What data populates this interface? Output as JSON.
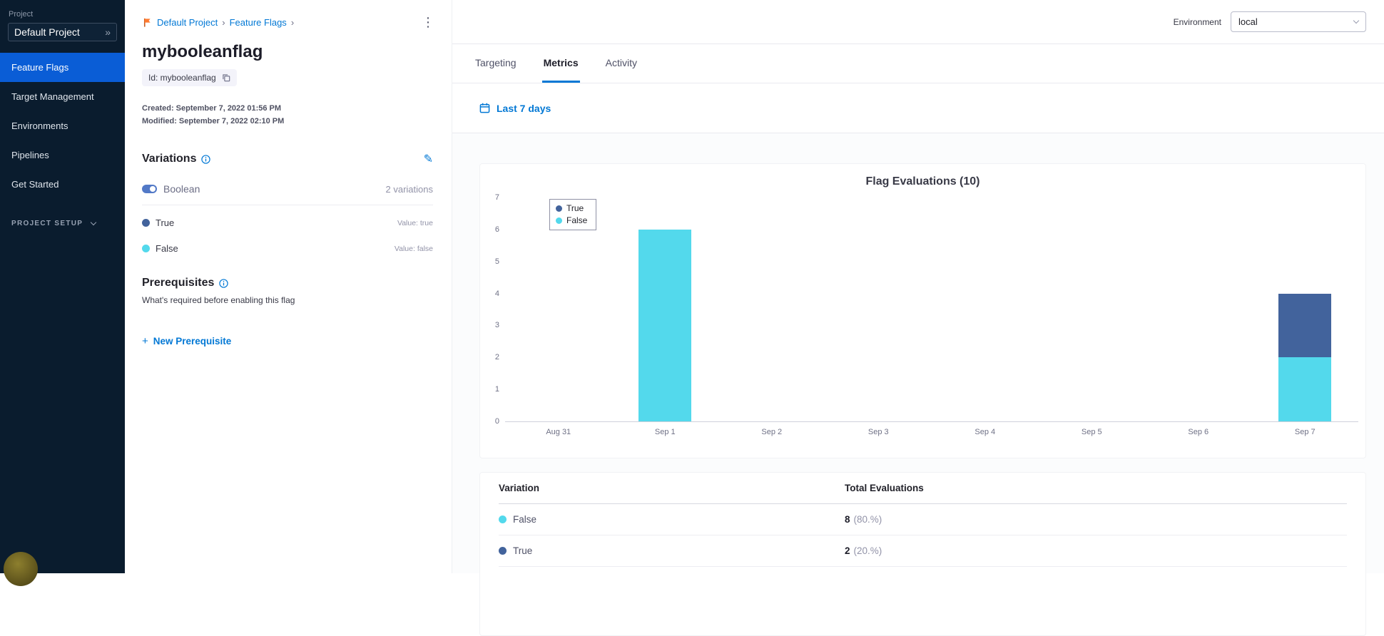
{
  "icons": {
    "double_chevron_right": "»",
    "kebab_menu": "⋮",
    "edit_pencil": "✎",
    "breadcrumb_separator": "›",
    "plus": "+"
  },
  "colors": {
    "primary_blue": "#0278d5",
    "active_nav_blue": "#0a5dd6",
    "sidebar_bg": "#0a1c2e",
    "true_variation": "#42639c",
    "false_variation": "#53d9ec"
  },
  "sidebar": {
    "project_label": "Project",
    "project_name": "Default Project",
    "items": [
      {
        "label": "Feature Flags",
        "active": true
      },
      {
        "label": "Target Management",
        "active": false
      },
      {
        "label": "Environments",
        "active": false
      },
      {
        "label": "Pipelines",
        "active": false
      },
      {
        "label": "Get Started",
        "active": false
      }
    ],
    "project_setup_label": "PROJECT SETUP"
  },
  "breadcrumb": {
    "project": "Default Project",
    "section": "Feature Flags"
  },
  "flag": {
    "name": "mybooleanflag",
    "id_chip": "Id: mybooleanflag",
    "created": "Created: September 7, 2022 01:56 PM",
    "modified": "Modified: September 7, 2022 02:10 PM"
  },
  "variations": {
    "title": "Variations",
    "type": "Boolean",
    "count_label": "2 variations",
    "items": [
      {
        "name": "True",
        "value_label": "Value: true",
        "color": "#42639c"
      },
      {
        "name": "False",
        "value_label": "Value: false",
        "color": "#53d9ec"
      }
    ]
  },
  "prerequisites": {
    "title": "Prerequisites",
    "description": "What's required before enabling this flag",
    "new_button": "New Prerequisite"
  },
  "environment": {
    "label": "Environment",
    "selected": "local"
  },
  "tabs": [
    {
      "label": "Targeting",
      "active": false
    },
    {
      "label": "Metrics",
      "active": true
    },
    {
      "label": "Activity",
      "active": false
    }
  ],
  "date_filter": "Last 7 days",
  "chart_data": {
    "type": "bar",
    "stacked": true,
    "title": "Flag Evaluations (10)",
    "categories": [
      "Aug 31",
      "Sep 1",
      "Sep 2",
      "Sep 3",
      "Sep 4",
      "Sep 5",
      "Sep 6",
      "Sep 7"
    ],
    "series": [
      {
        "name": "True",
        "color": "#42639c",
        "values": [
          0,
          0,
          0,
          0,
          0,
          0,
          0,
          2
        ]
      },
      {
        "name": "False",
        "color": "#53d9ec",
        "values": [
          0,
          6,
          0,
          0,
          0,
          0,
          0,
          2
        ]
      }
    ],
    "xlabel": "",
    "ylabel": "",
    "ylim": [
      0,
      7
    ],
    "yticks": [
      0,
      1,
      2,
      3,
      4,
      5,
      6,
      7
    ],
    "grid": false,
    "legend_position": "top-left"
  },
  "evaluations_table": {
    "headers": [
      "Variation",
      "Total Evaluations"
    ],
    "rows": [
      {
        "variation": "False",
        "color": "#53d9ec",
        "total": "8",
        "percent": "(80.%)"
      },
      {
        "variation": "True",
        "color": "#42639c",
        "total": "2",
        "percent": "(20.%)"
      }
    ]
  }
}
